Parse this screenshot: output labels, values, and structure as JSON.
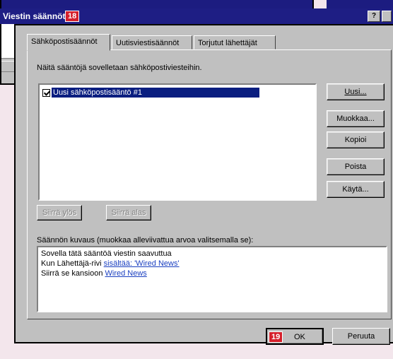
{
  "dialog": {
    "title": "Viestin säännöt",
    "title_badge": "18",
    "help_label": "?"
  },
  "tabs": [
    {
      "label": "Sähköpostisäännöt"
    },
    {
      "label": "Uutisviestisäännöt"
    },
    {
      "label": "Torjutut lähettäjät"
    }
  ],
  "intro_text": "Näitä sääntöjä sovelletaan sähköpostiviesteihin.",
  "rules": [
    {
      "label": "Uusi sähköpostisääntö #1",
      "checked": true
    }
  ],
  "side_buttons": {
    "new": "Uusi...",
    "edit": "Muokkaa...",
    "copy": "Kopioi",
    "remove": "Poista",
    "apply": "Käytä..."
  },
  "move_buttons": {
    "up": "Siirrä ylös",
    "down": "Siirrä alas"
  },
  "description": {
    "label": "Säännön kuvaus (muokkaa alleviivattua arvoa valitsemalla se):",
    "line1": "Sovella tätä sääntöä viestin saavuttua",
    "line2_prefix": "Kun Lähettäjä-rivi ",
    "line2_link": "sisältää: 'Wired News'",
    "line3_prefix": "Siirrä se kansioon ",
    "line3_link": "Wired News"
  },
  "footer": {
    "ok_badge": "19",
    "ok_label": "OK",
    "cancel_label": "Peruuta"
  }
}
